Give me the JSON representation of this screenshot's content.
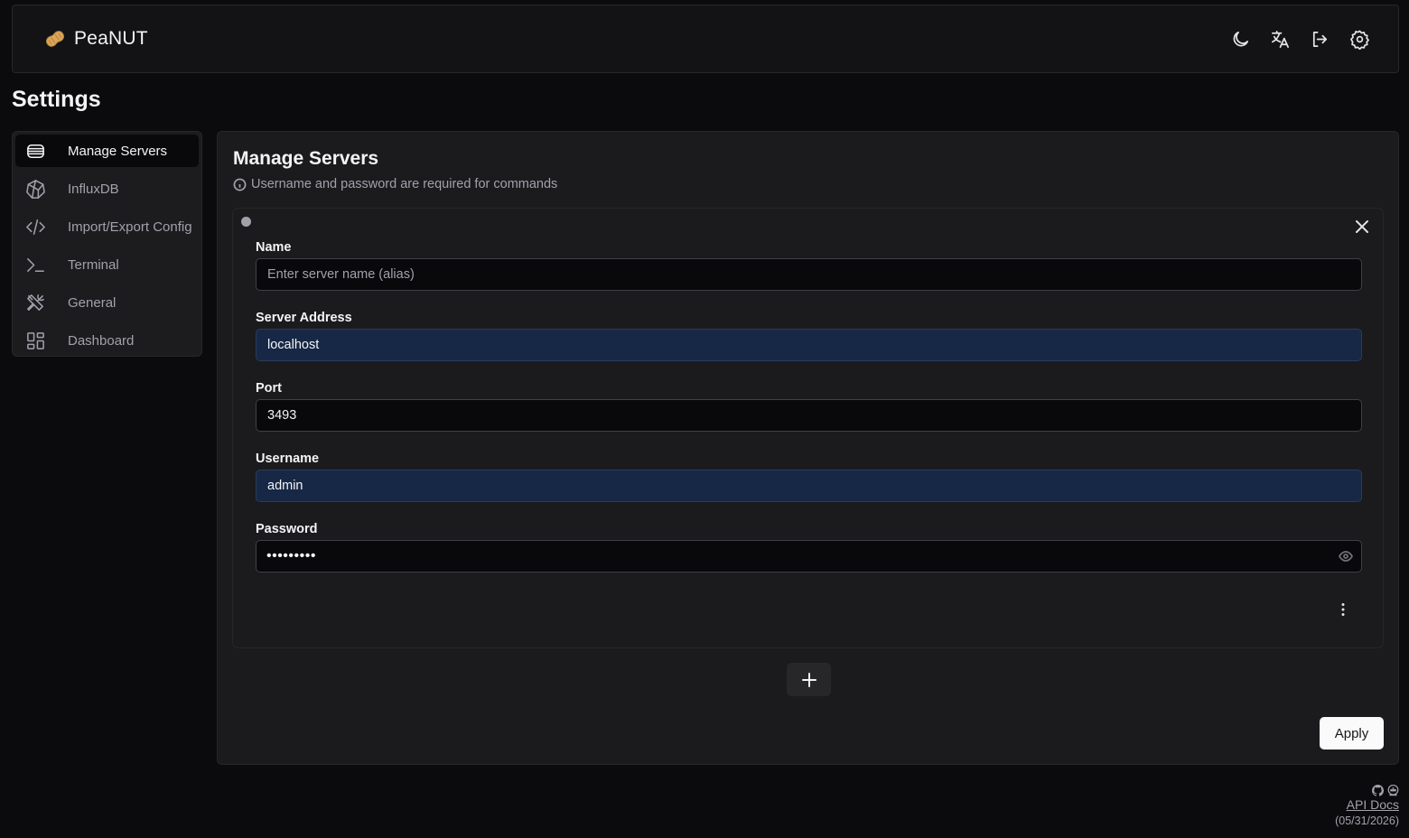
{
  "app": {
    "name": "PeaNUT",
    "logo_icon": "peanut-icon"
  },
  "header": {
    "actions": [
      "moon-icon",
      "translate-icon",
      "logout-icon",
      "gear-icon"
    ]
  },
  "page": {
    "title": "Settings"
  },
  "sidebar": {
    "items": [
      {
        "label": "Manage Servers",
        "icon": "server-icon",
        "active": true
      },
      {
        "label": "InfluxDB",
        "icon": "influxdb-icon"
      },
      {
        "label": "Import/Export Config",
        "icon": "code-icon"
      },
      {
        "label": "Terminal",
        "icon": "terminal-icon"
      },
      {
        "label": "General",
        "icon": "tools-icon"
      },
      {
        "label": "Dashboard",
        "icon": "dashboard-icon"
      }
    ]
  },
  "main": {
    "title": "Manage Servers",
    "note": "Username and password are required for commands",
    "server": {
      "status_color": "#a1a1aa",
      "name_label": "Name",
      "name_placeholder": "Enter server name (alias)",
      "name_value": "",
      "address_label": "Server Address",
      "address_value": "localhost",
      "port_label": "Port",
      "port_value": "3493",
      "username_label": "Username",
      "username_value": "admin",
      "password_label": "Password",
      "password_masked": "•••••••••"
    },
    "apply_label": "Apply"
  },
  "footer": {
    "api_docs": "API Docs",
    "date": "(05/31/2026)"
  },
  "colors": {
    "background": "#0b0b0d",
    "panel": "#1b1b1e",
    "autofill": "#172846",
    "accent_button": "#fafafa"
  }
}
